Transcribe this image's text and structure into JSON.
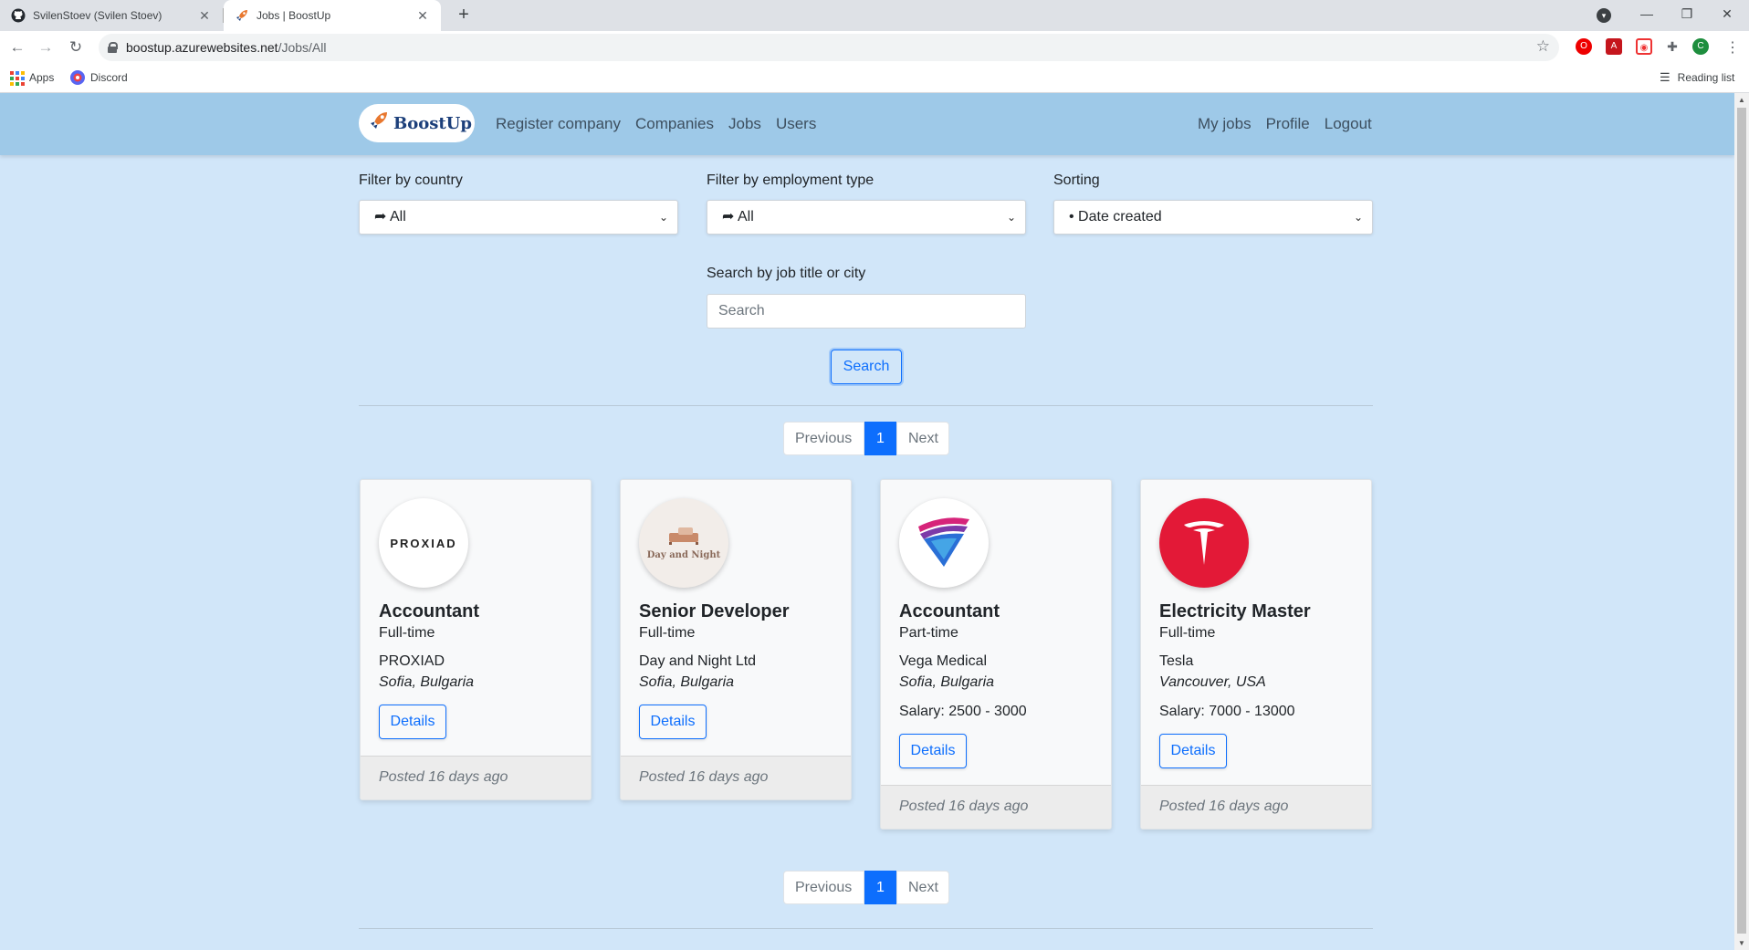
{
  "browser": {
    "tabs": [
      {
        "title": "SvilenStoev (Svilen Stoev)",
        "active": false
      },
      {
        "title": "Jobs | BoostUp",
        "active": true
      }
    ],
    "url_host": "boostup.azurewebsites.net",
    "url_path": "/Jobs/All",
    "profile_initial": "C",
    "bookmarks": [
      "Apps",
      "Discord"
    ],
    "reading_list": "Reading list"
  },
  "nav": {
    "brand": "BoostUp",
    "left_links": [
      "Register company",
      "Companies",
      "Jobs",
      "Users"
    ],
    "right_links": [
      "My jobs",
      "Profile",
      "Logout"
    ]
  },
  "filters": {
    "country_label": "Filter by country",
    "country_value": "➦ All",
    "employment_label": "Filter by employment type",
    "employment_value": "➦ All",
    "sorting_label": "Sorting",
    "sorting_value": "• Date created",
    "search_label": "Search by job title or city",
    "search_placeholder": "Search",
    "search_button": "Search"
  },
  "pagination": {
    "previous": "Previous",
    "current": "1",
    "next": "Next"
  },
  "jobs": [
    {
      "title": "Accountant",
      "type": "Full-time",
      "company": "PROXIAD",
      "location": "Sofia, Bulgaria",
      "salary": "",
      "details": "Details",
      "posted": "Posted 16 days ago",
      "logo_text": "PROXIAD"
    },
    {
      "title": "Senior Developer",
      "type": "Full-time",
      "company": "Day and Night Ltd",
      "location": "Sofia, Bulgaria",
      "salary": "",
      "details": "Details",
      "posted": "Posted 16 days ago",
      "logo_text": "Day and Night"
    },
    {
      "title": "Accountant",
      "type": "Part-time",
      "company": "Vega Medical",
      "location": "Sofia, Bulgaria",
      "salary": "Salary: 2500 - 3000",
      "details": "Details",
      "posted": "Posted 16 days ago",
      "logo_text": ""
    },
    {
      "title": "Electricity Master",
      "type": "Full-time",
      "company": "Tesla",
      "location": "Vancouver, USA",
      "salary": "Salary: 7000 - 13000",
      "details": "Details",
      "posted": "Posted 16 days ago",
      "logo_text": ""
    }
  ],
  "colors": {
    "nav_bg": "#9ec9e8",
    "page_bg": "#d1e6f9",
    "primary": "#0d6efd",
    "tesla_red": "#e31937"
  }
}
